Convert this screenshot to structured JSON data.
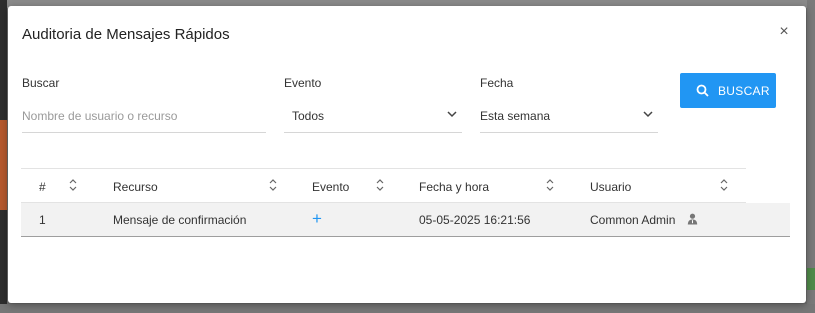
{
  "modal": {
    "title": "Auditoria de Mensajes Rápidos",
    "close_label": "×"
  },
  "filters": {
    "search": {
      "label": "Buscar",
      "value": "",
      "placeholder": "Nombre de usuario o recurso"
    },
    "event": {
      "label": "Evento",
      "selected": "Todos"
    },
    "date": {
      "label": "Fecha",
      "selected": "Esta semana"
    },
    "search_button_label": "BUSCAR"
  },
  "table": {
    "columns": [
      "#",
      "Recurso",
      "Evento",
      "Fecha y hora",
      "Usuario"
    ],
    "rows": [
      {
        "index": "1",
        "resource": "Mensaje de confirmación",
        "event_symbol": "+",
        "datetime": "05-05-2025 16:21:56",
        "user": "Common Admin"
      }
    ]
  },
  "colors": {
    "accent": "#2196f3",
    "row_highlight": "#f2f2f2"
  },
  "icons": {
    "close": "close-icon",
    "search": "search-icon",
    "dropdown": "chevron-down-icon",
    "sort": "sort-icon",
    "event_add": "plus-icon",
    "user": "user-icon"
  }
}
